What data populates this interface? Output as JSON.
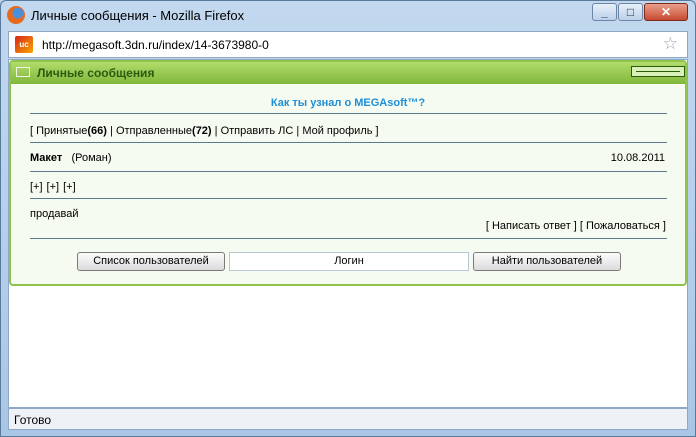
{
  "window": {
    "title": "Личные сообщения - Mozilla Firefox",
    "minimize": "_",
    "maximize": "□",
    "close": "✕"
  },
  "address": {
    "url": "http://megasoft.3dn.ru/index/14-3673980-0",
    "site_icon": "ucoz-icon"
  },
  "panel": {
    "title": "Личные сообщения",
    "topic": "Как ты узнал о MEGAsoft™?",
    "tabs": {
      "open": "[ ",
      "received_label": "Принятые",
      "received_count": "(66)",
      "sep1": " | ",
      "sent_label": "Отправленные",
      "sent_count": "(72)",
      "sep2": " | ",
      "send": "Отправить ЛС",
      "sep3": " | ",
      "profile": "Мой профиль",
      "close": " ]"
    },
    "message": {
      "author": "Макет",
      "author_name": "(Роман)",
      "date": "10.08.2011",
      "plus1": "[+]",
      "plus2": "[+]",
      "plus3": "[+]",
      "body": "продавай",
      "actions": {
        "open": "[ ",
        "reply": "Написать ответ",
        "mid": " ] [ ",
        "complain": "Пожаловаться",
        "close": " ]"
      }
    },
    "buttons": {
      "user_list": "Список пользователей",
      "login_value": "Логин",
      "find_users": "Найти пользователей"
    }
  },
  "status": {
    "text": "Готово"
  },
  "colors": {
    "header_green": "#7fb73a",
    "topic_blue": "#1f8fd8",
    "panel_border": "#8fc34c"
  }
}
